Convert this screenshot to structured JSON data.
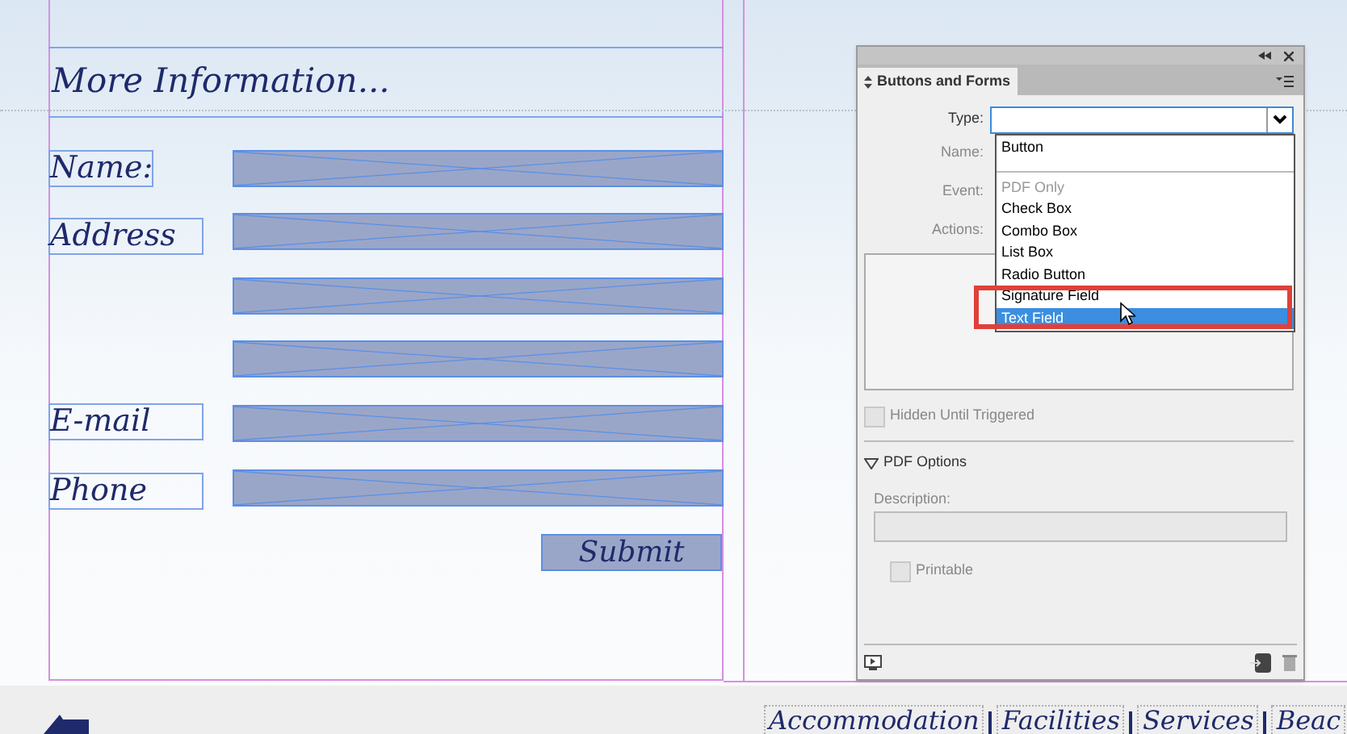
{
  "document": {
    "heading": "More Information...",
    "labels": [
      "Name:",
      "Address",
      "E-mail",
      "Phone"
    ],
    "submit": "Submit",
    "nav": [
      "Accommodation",
      "Facilities",
      "Services",
      "Beac"
    ]
  },
  "panel": {
    "title": "Buttons and Forms",
    "type_label": "Type:",
    "name_label": "Name:",
    "event_label": "Event:",
    "actions_label": "Actions:",
    "dropdown": [
      {
        "label": "Button",
        "disabled": false,
        "selected": false
      },
      {
        "label": "PDF Only",
        "disabled": true,
        "selected": false
      },
      {
        "label": "Check Box",
        "disabled": false,
        "selected": false
      },
      {
        "label": "Combo Box",
        "disabled": false,
        "selected": false
      },
      {
        "label": "List Box",
        "disabled": false,
        "selected": false
      },
      {
        "label": "Radio Button",
        "disabled": false,
        "selected": false
      },
      {
        "label": "Signature Field",
        "disabled": false,
        "selected": false
      },
      {
        "label": "Text Field",
        "disabled": false,
        "selected": true
      }
    ],
    "hidden_until_triggered": {
      "label": "Hidden Until Triggered",
      "checked": false
    },
    "pdf_options": {
      "label": "PDF Options",
      "expanded": true,
      "description_label": "Description:",
      "printable": {
        "label": "Printable",
        "checked": false
      }
    }
  }
}
